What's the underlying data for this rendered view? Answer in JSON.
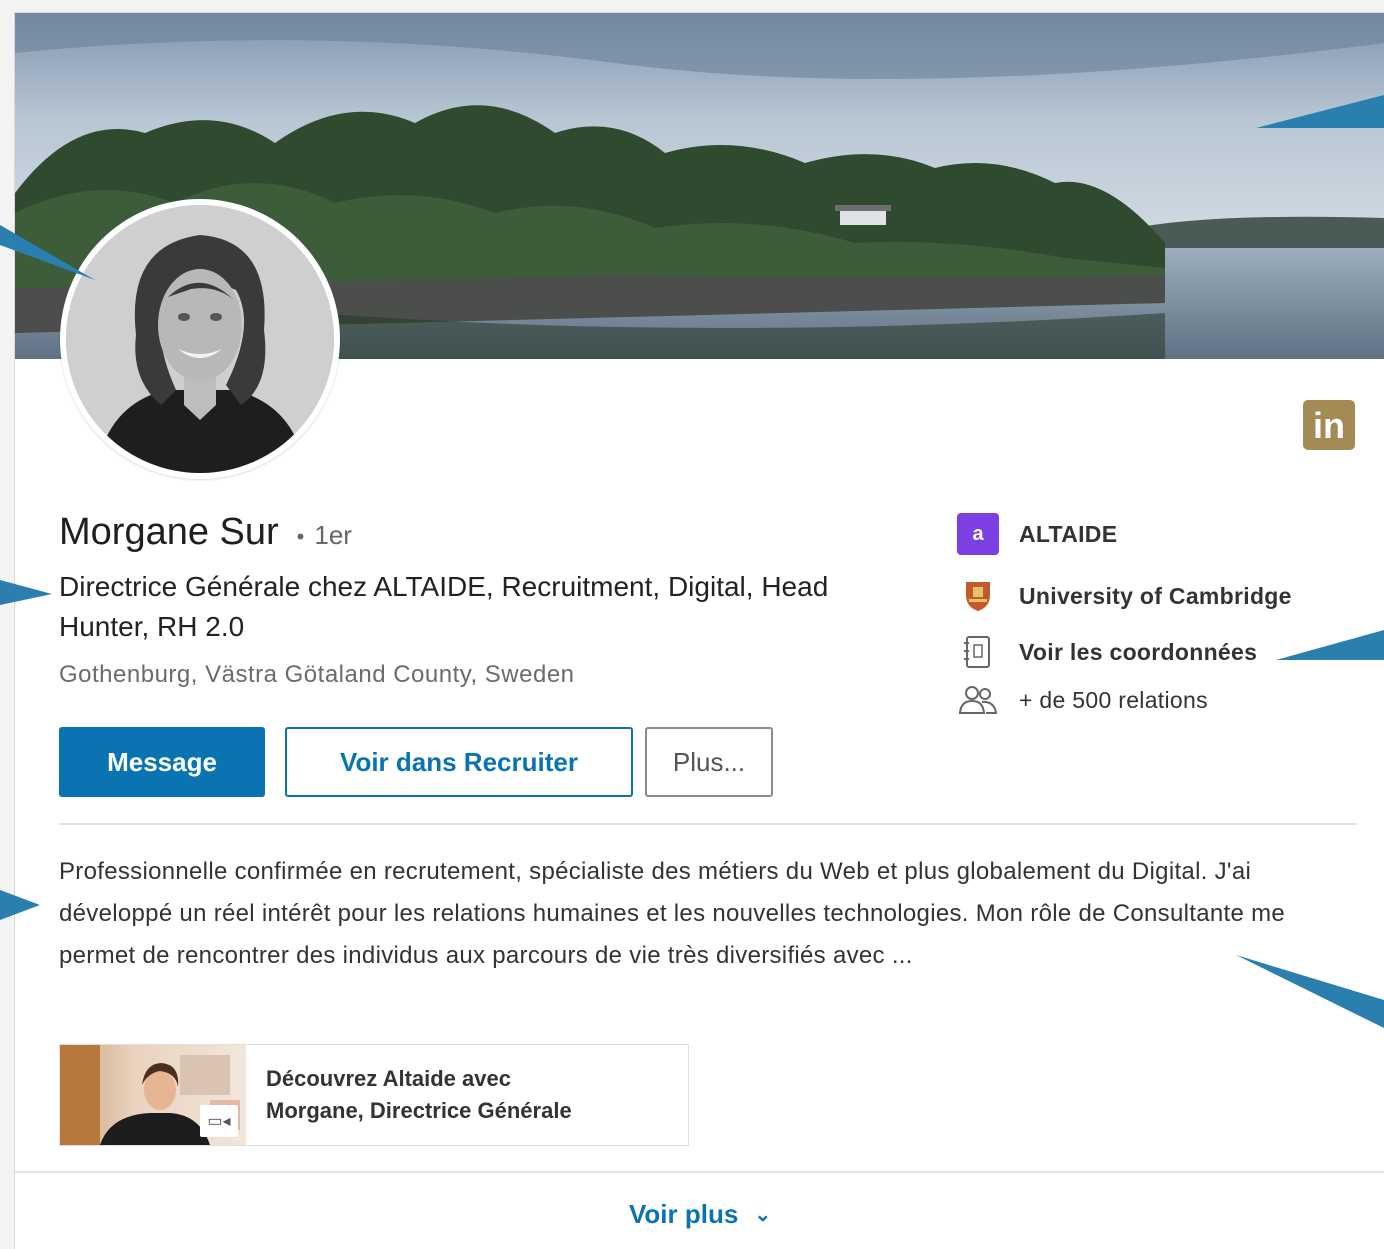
{
  "profile": {
    "name": "Morgane Sur",
    "degree_separator": "•",
    "degree": "1er",
    "headline": "Directrice Générale chez ALTAIDE, Recruitment, Digital, Head Hunter, RH 2.0",
    "location": "Gothenburg, Västra Götaland County, Sweden"
  },
  "actions": {
    "message_label": "Message",
    "recruiter_label": "Voir dans Recruiter",
    "more_label": "Plus..."
  },
  "side": {
    "company": "ALTAIDE",
    "university": "University of Cambridge",
    "contact_info": "Voir les coordonnées",
    "connections": "+ de 500 relations"
  },
  "summary": {
    "text": "Professionnelle confirmée en recrutement, spécialiste des métiers du Web et plus globalement du Digital. J'ai développé un réel intérêt pour les relations humaines et les nouvelles technologies. Mon rôle de Consultante me permet de rencontrer des individus aux parcours de vie très diversifiés avec ..."
  },
  "media": {
    "title_line1": "Découvrez Altaide avec",
    "title_line2": "Morgane, Directrice Générale",
    "video_icon": "video-camera-icon"
  },
  "footer": {
    "see_more_label": "Voir plus",
    "chevron": "⌄"
  },
  "brand": {
    "linkedin_logo_text": "in",
    "linkedin_color": "#a48a54",
    "primary_blue": "#0a73b1",
    "altaide_purple": "#7b3fe4",
    "callout_color": "#2a7fae"
  },
  "icons": {
    "altaide": "altaide-logo-icon",
    "university": "university-crest-icon",
    "contact": "contact-card-icon",
    "connections": "people-icon"
  }
}
